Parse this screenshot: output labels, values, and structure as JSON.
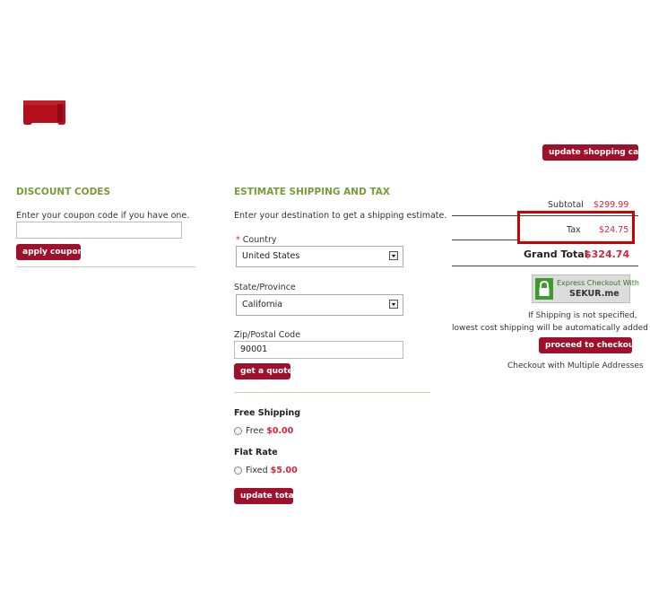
{
  "header": {
    "update_cart_label": "update shopping cart"
  },
  "discount": {
    "title": "DISCOUNT CODES",
    "prompt": "Enter your coupon code if you have one.",
    "coupon_value": "",
    "apply_label": "apply coupon"
  },
  "shipping": {
    "title": "ESTIMATE SHIPPING AND TAX",
    "intro": "Enter your destination to get a shipping estimate.",
    "required_mark": "*",
    "country_label": "Country",
    "country_value": "United States",
    "state_label": "State/Province",
    "state_value": "California",
    "zip_label": "Zip/Postal Code",
    "zip_value": "90001",
    "quote_label": "get a quote",
    "free_title": "Free Shipping",
    "free_option": "Free",
    "free_price": "$0.00",
    "flat_title": "Flat Rate",
    "flat_option": "Fixed",
    "flat_price": "$5.00",
    "update_total_label": "update total"
  },
  "totals": {
    "subtotal_label": "Subtotal",
    "subtotal_value": "$299.99",
    "tax_label": "Tax",
    "tax_value": "$24.75",
    "grand_label": "Grand Total",
    "grand_value": "$324.74",
    "sekur_line1": "Express Checkout With",
    "sekur_line2": "SEKUR.me",
    "note_line1": "If Shipping is not specified,",
    "note_line2": "lowest cost shipping will be automatically added",
    "checkout_label": "proceed to checkout",
    "multi_label": "Checkout with Multiple Addresses"
  },
  "colors": {
    "accent": "#a0102a",
    "section_title": "#7a9b3a",
    "price": "#d4263a",
    "highlight_box": "#cc0000"
  }
}
